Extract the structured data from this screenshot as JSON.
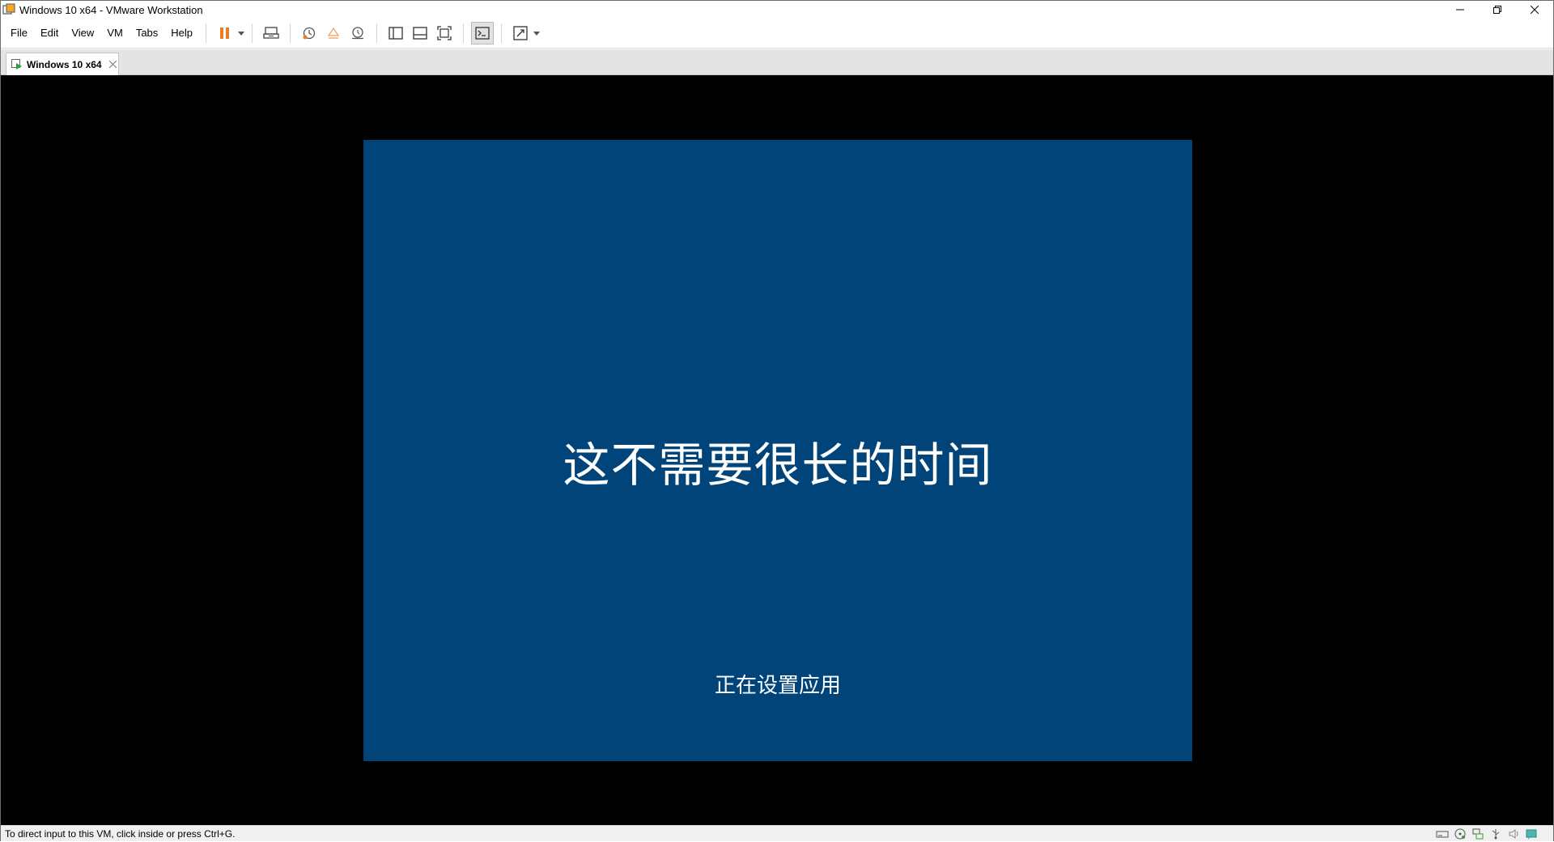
{
  "window": {
    "title": "Windows 10 x64 - VMware Workstation"
  },
  "menu": {
    "items": [
      "File",
      "Edit",
      "View",
      "VM",
      "Tabs",
      "Help"
    ]
  },
  "tabs": [
    {
      "label": "Windows 10 x64"
    }
  ],
  "guest": {
    "heading": "这不需要很长的时间",
    "subtext": "正在设置应用"
  },
  "status": {
    "hint": "To direct input to this VM, click inside or press Ctrl+G."
  },
  "colors": {
    "guest_background": "#00447a",
    "vm_background": "#000000",
    "pause_accent": "#f07a1f"
  },
  "icons": {
    "toolbar": [
      "pause-icon",
      "send-ctrl-alt-del-icon",
      "snapshot-icon",
      "revert-snapshot-icon",
      "snapshot-manager-icon",
      "library-view-icon",
      "thumbnail-bar-icon",
      "full-screen-icon",
      "console-view-icon",
      "stretch-guest-icon"
    ],
    "status": [
      "hard-disk-icon",
      "cd-dvd-icon",
      "network-icon",
      "usb-icon",
      "sound-icon",
      "message-icon"
    ]
  }
}
